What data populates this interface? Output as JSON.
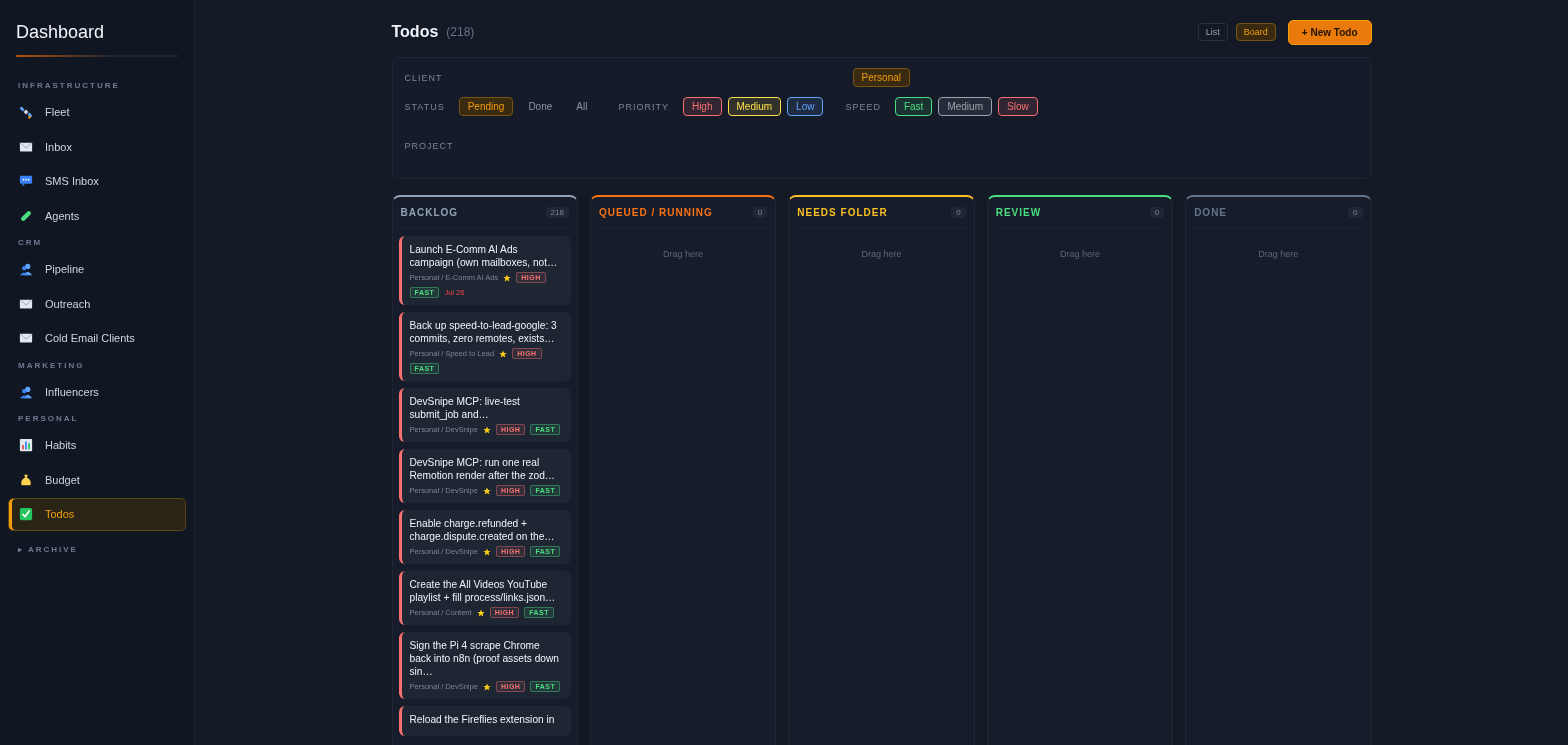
{
  "sidebar": {
    "title": "Dashboard",
    "sections": [
      {
        "label": "INFRASTRUCTURE",
        "items": [
          {
            "label": "Fleet",
            "kind": "satellite",
            "selected": false
          },
          {
            "label": "Inbox",
            "kind": "envelope",
            "selected": false
          },
          {
            "label": "SMS Inbox",
            "kind": "chat",
            "selected": false
          },
          {
            "label": "Agents",
            "kind": "pill",
            "selected": false
          }
        ]
      },
      {
        "label": "CRM",
        "items": [
          {
            "label": "Pipeline",
            "kind": "people",
            "selected": false
          },
          {
            "label": "Outreach",
            "kind": "envelope",
            "selected": false
          },
          {
            "label": "Cold Email Clients",
            "kind": "envelope",
            "selected": false
          }
        ]
      },
      {
        "label": "MARKETING",
        "items": [
          {
            "label": "Influencers",
            "kind": "people",
            "selected": false
          }
        ]
      },
      {
        "label": "PERSONAL",
        "items": [
          {
            "label": "Habits",
            "kind": "chart",
            "selected": false
          },
          {
            "label": "Budget",
            "kind": "moneybag",
            "selected": false
          },
          {
            "label": "Todos",
            "kind": "check",
            "selected": true
          }
        ]
      }
    ],
    "archive": {
      "caret": "▸",
      "label": "ARCHIVE"
    }
  },
  "header": {
    "title": "Todos",
    "count": "(218)",
    "views": [
      {
        "label": "List",
        "selected": false
      },
      {
        "label": "Board",
        "selected": true
      }
    ],
    "new_button": "+ New Todo"
  },
  "filters": {
    "client": {
      "label": "CLIENT",
      "chips": [
        {
          "label": "Personal",
          "selected": true
        }
      ]
    },
    "status": {
      "label": "STATUS",
      "chips": [
        {
          "label": "Pending",
          "selected": true
        },
        {
          "label": "Done",
          "selected": false
        },
        {
          "label": "All",
          "selected": false
        }
      ]
    },
    "priority": {
      "label": "PRIORITY",
      "chips": [
        {
          "label": "High",
          "color": "#f87171"
        },
        {
          "label": "Medium",
          "color": "#fde047"
        },
        {
          "label": "Low",
          "color": "#60a5fa"
        }
      ]
    },
    "speed": {
      "label": "SPEED",
      "chips": [
        {
          "label": "Fast",
          "color": "#4ade80"
        },
        {
          "label": "Medium",
          "color": "#9ca3af"
        },
        {
          "label": "Slow",
          "color": "#f87171"
        }
      ]
    },
    "project": {
      "label": "PROJECT"
    }
  },
  "columns": [
    {
      "title": "BACKLOG",
      "count": "218",
      "color": "#94a3b8",
      "cards": [
        {
          "title": "Launch E-Comm AI Ads campaign (own mailboxes, not…",
          "project": "Personal / E-Comm AI Ads",
          "starred": true,
          "priority": "HIGH",
          "speed": "FAST",
          "due": "Jul 26"
        },
        {
          "title": "Back up speed-to-lead-google: 3 commits, zero remotes, exists…",
          "project": "Personal / Speed to Lead",
          "starred": true,
          "priority": "HIGH",
          "speed": "FAST"
        },
        {
          "title": "DevSnipe MCP: live-test submit_job and…",
          "project": "Personal / DevSnipe",
          "starred": true,
          "priority": "HIGH",
          "speed": "FAST"
        },
        {
          "title": "DevSnipe MCP: run one real Remotion render after the zod…",
          "project": "Personal / DevSnipe",
          "starred": true,
          "priority": "HIGH",
          "speed": "FAST"
        },
        {
          "title": "Enable charge.refunded + charge.dispute.created on the…",
          "project": "Personal / DevSnipe",
          "starred": true,
          "priority": "HIGH",
          "speed": "FAST"
        },
        {
          "title": "Create the All Videos YouTube playlist + fill process/links.json…",
          "project": "Personal / Content",
          "starred": true,
          "priority": "HIGH",
          "speed": "FAST"
        },
        {
          "title": "Sign the Pi 4 scrape Chrome back into n8n (proof assets down sin…",
          "project": "Personal / DevSnipe",
          "starred": true,
          "priority": "HIGH",
          "speed": "FAST"
        },
        {
          "title": "Reload the Fireflies extension in",
          "color": "#f87171"
        }
      ]
    },
    {
      "title": "QUEUED / RUNNING",
      "count": "0",
      "color": "#f97316",
      "empty_text": "Drag here"
    },
    {
      "title": "NEEDS FOLDER",
      "count": "0",
      "color": "#fbbf24",
      "empty_text": "Drag here"
    },
    {
      "title": "REVIEW",
      "count": "0",
      "color": "#4ade80",
      "empty_text": "Drag here"
    },
    {
      "title": "DONE",
      "count": "0",
      "color": "#64748b",
      "empty_text": "Drag here"
    }
  ]
}
